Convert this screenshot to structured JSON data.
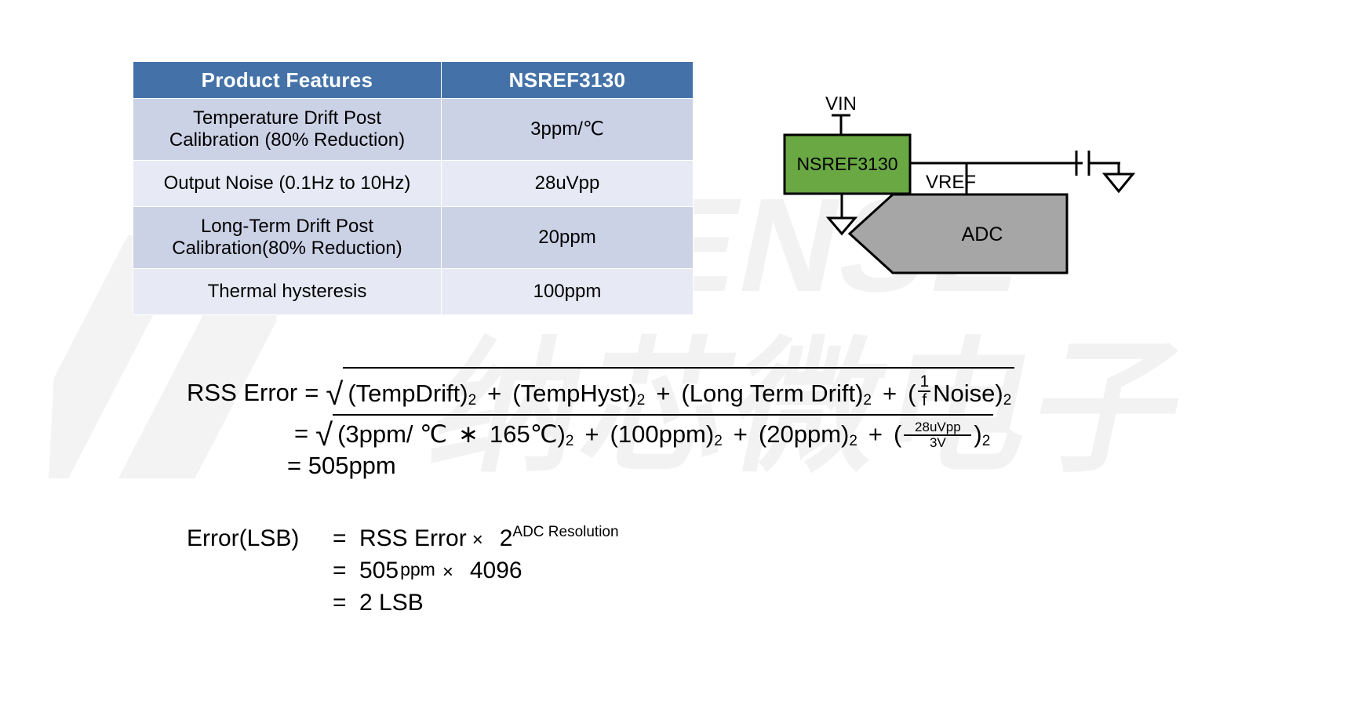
{
  "watermark": {
    "latin": "NOVOSENSE",
    "cjk": "纳芯微电子"
  },
  "table": {
    "headers": [
      "Product Features",
      "NSREF3130"
    ],
    "rows": [
      {
        "feature": "Temperature Drift Post Calibration (80% Reduction)",
        "feature_line1": "Temperature Drift Post",
        "feature_line2": "Calibration (80% Reduction)",
        "value": "3ppm/℃"
      },
      {
        "feature": "Output Noise (0.1Hz to 10Hz)",
        "feature_line1": "Output Noise (0.1Hz to 10Hz)",
        "feature_line2": "",
        "value": "28uVpp"
      },
      {
        "feature": "Long-Term Drift Post Calibration(80% Reduction)",
        "feature_line1": "Long-Term Drift Post",
        "feature_line2": "Calibration(80% Reduction)",
        "value": "20ppm"
      },
      {
        "feature": "Thermal hysteresis",
        "feature_line1": "Thermal hysteresis",
        "feature_line2": "",
        "value": "100ppm"
      }
    ],
    "colors": {
      "header_bg": "#4472a8",
      "header_text": "#ffffff",
      "band_a": "#ccd2e6",
      "band_b": "#e7eaf4"
    }
  },
  "circuit": {
    "vin_label": "VIN",
    "device_label": "NSREF3130",
    "vref_label": "VREF",
    "adc_label": "ADC",
    "colors": {
      "device_fill": "#6aa844",
      "adc_fill": "#a6a6a6",
      "wire": "#000000"
    }
  },
  "rss_formula": {
    "label": "RSS Error",
    "eq": "=",
    "symbolic": {
      "t1_open": "(TempDrift)",
      "t1_sup": "2",
      "plus1": "+",
      "t2_open": "(TempHyst)",
      "t2_sup": "2",
      "plus2": "+",
      "t3_open": "(Long Term Drift)",
      "t3_sup": "2",
      "plus3": "+",
      "t4_open": "(",
      "t4_num": "1",
      "t4_den": "f",
      "t4_text": "Noise)",
      "t4_sup": "2"
    },
    "numeric": {
      "n1_open": "(3ppm/ ℃",
      "n1_star": "∗",
      "n1_val": "165℃)",
      "n1_sup": "2",
      "plus1": "+",
      "n2": "(100ppm)",
      "n2_sup": "2",
      "plus2": "+",
      "n3": "(20ppm)",
      "n3_sup": "2",
      "plus3": "+",
      "n4_open": "(",
      "n4_num": "28uVpp",
      "n4_den": "3V",
      "n4_close": ")",
      "n4_sup": "2"
    },
    "result": "= 505ppm"
  },
  "lsb_formula": {
    "label": "Error(LSB)",
    "rows": [
      {
        "eq": "=",
        "expr": "RSS Error",
        "times": "×",
        "base": "2",
        "exponent": "ADC Resolution"
      },
      {
        "eq": "=",
        "value": "505",
        "unit": "ppm",
        "times": "×",
        "operand": "4096"
      },
      {
        "eq": "=",
        "value": "2 LSB"
      }
    ]
  }
}
